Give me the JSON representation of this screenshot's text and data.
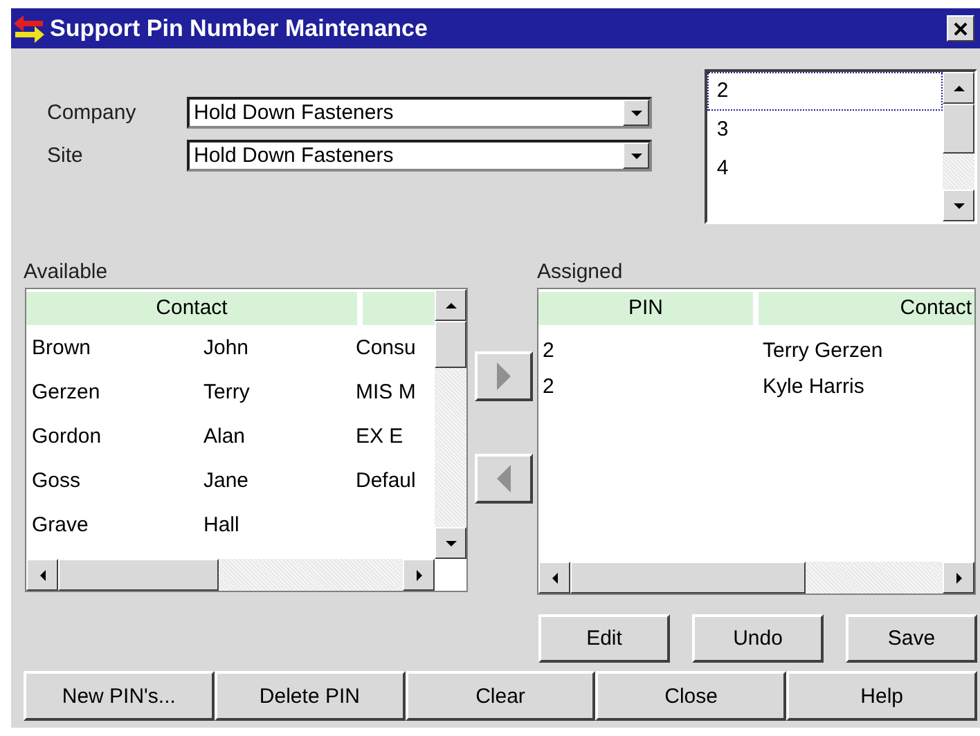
{
  "window": {
    "title": "Support Pin Number Maintenance"
  },
  "company": {
    "label": "Company",
    "value": "Hold Down Fasteners"
  },
  "site": {
    "label": "Site",
    "value": "Hold Down Fasteners"
  },
  "pin_list": {
    "items": [
      {
        "text": "2",
        "focused": true
      },
      {
        "text": "3",
        "focused": false
      },
      {
        "text": "4",
        "focused": false
      }
    ]
  },
  "available": {
    "label": "Available",
    "header": "Contact",
    "rows": [
      [
        "Brown",
        "John",
        "Consu"
      ],
      [
        "Gerzen",
        "Terry",
        "MIS M"
      ],
      [
        "Gordon",
        "Alan",
        "EX E"
      ],
      [
        "Goss",
        "Jane",
        "Defaul"
      ],
      [
        "Grave",
        "Hall"
      ]
    ]
  },
  "assigned": {
    "label": "Assigned",
    "columns": [
      "PIN",
      "Contact"
    ],
    "rows": [
      [
        "2",
        "Terry Gerzen"
      ],
      [
        "2",
        "Kyle Harris"
      ]
    ]
  },
  "edit_buttons": [
    {
      "label": "Edit"
    },
    {
      "label": "Undo"
    },
    {
      "label": "Save"
    }
  ],
  "bottom_buttons": [
    {
      "label": "New PIN's..."
    },
    {
      "label": "Delete PIN"
    },
    {
      "label": "Clear"
    },
    {
      "label": "Close"
    },
    {
      "label": "Help"
    }
  ]
}
